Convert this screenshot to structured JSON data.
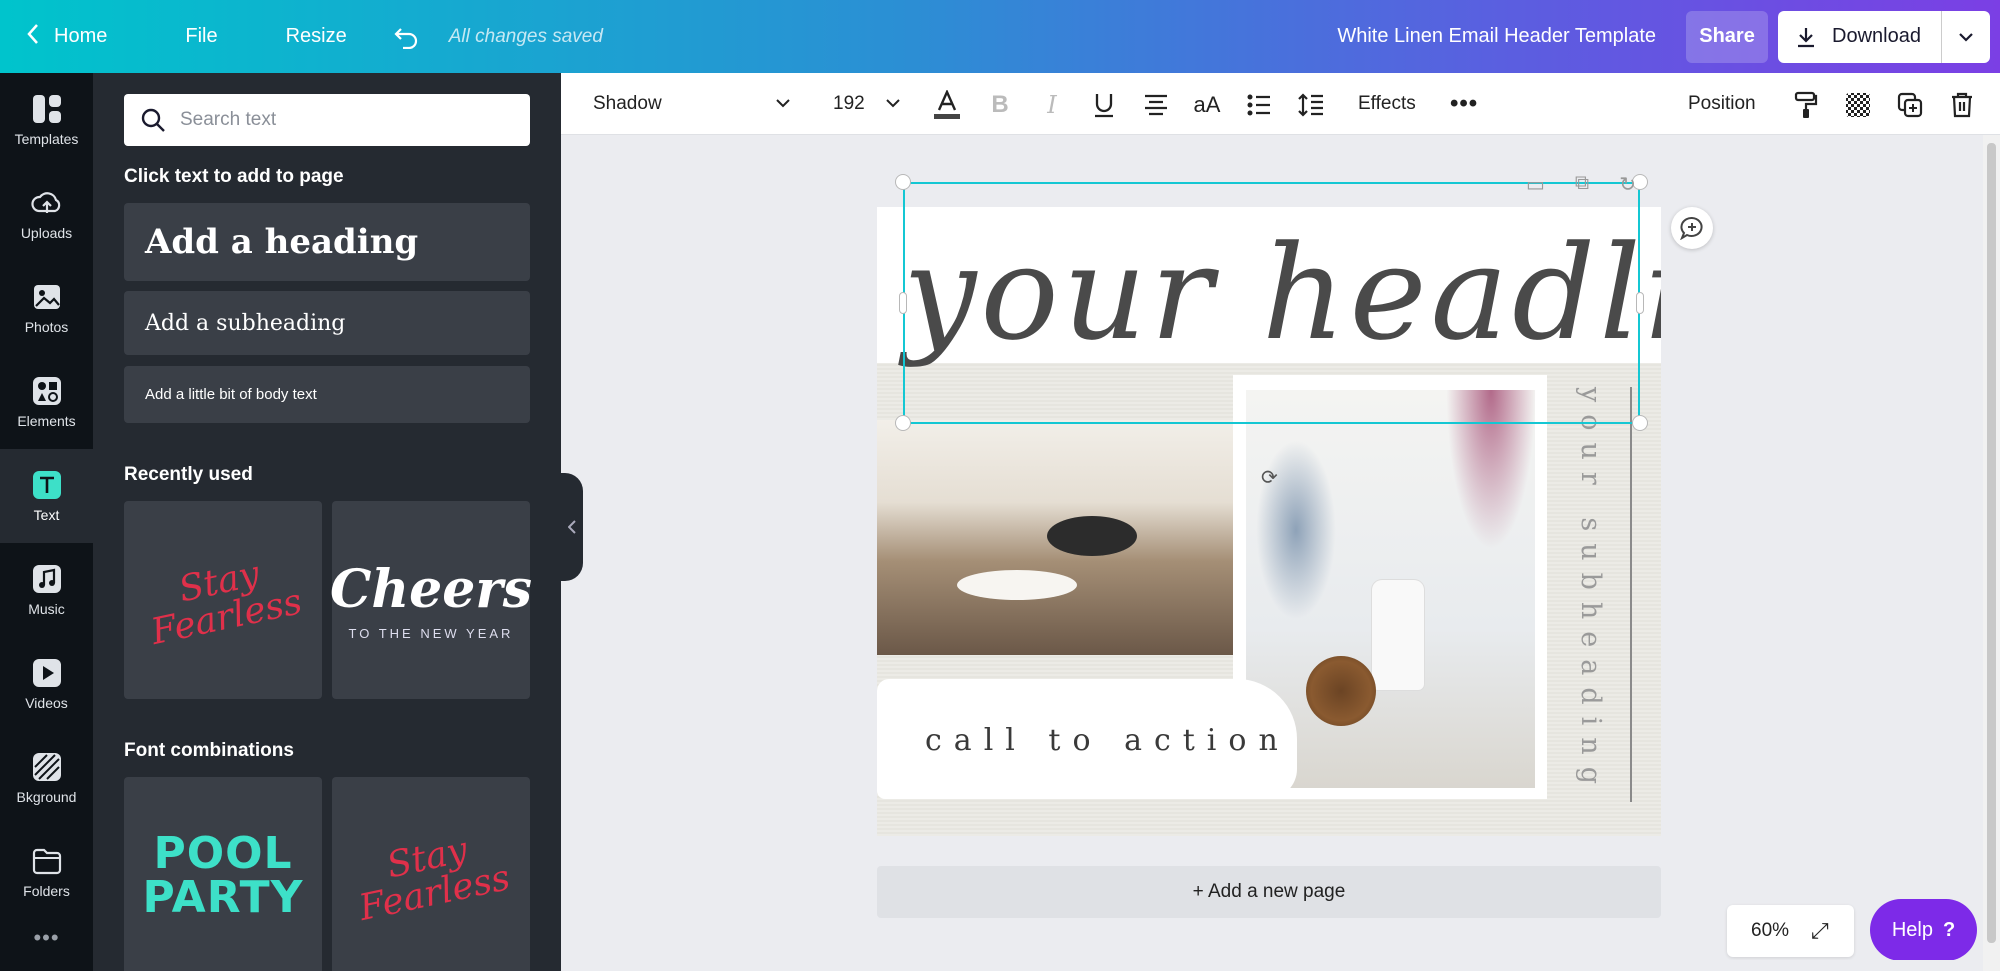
{
  "topbar": {
    "home_label": "Home",
    "file_label": "File",
    "resize_label": "Resize",
    "saved_status": "All changes saved",
    "doc_title": "White Linen Email Header Template",
    "share_label": "Share",
    "download_label": "Download"
  },
  "rail": {
    "items": [
      {
        "label": "Templates",
        "icon": "templates-icon"
      },
      {
        "label": "Uploads",
        "icon": "upload-icon"
      },
      {
        "label": "Photos",
        "icon": "photo-icon"
      },
      {
        "label": "Elements",
        "icon": "elements-icon"
      },
      {
        "label": "Text",
        "icon": "text-icon"
      },
      {
        "label": "Music",
        "icon": "music-icon"
      },
      {
        "label": "Videos",
        "icon": "video-icon"
      },
      {
        "label": "Bkground",
        "icon": "background-icon"
      },
      {
        "label": "Folders",
        "icon": "folder-icon"
      }
    ],
    "more_label": "•••"
  },
  "panel": {
    "search_placeholder": "Search text",
    "click_text_title": "Click text to add to page",
    "add_heading": "Add a heading",
    "add_subheading": "Add a subheading",
    "add_body": "Add a little bit of body text",
    "recently_used_title": "Recently used",
    "recent_1_text": "Stay Fearless",
    "recent_2_big": "Cheers",
    "recent_2_small": "TO THE NEW YEAR",
    "font_combos_title": "Font combinations",
    "combo_1_text": "POOL PARTY",
    "combo_2_text": "Stay Fearless"
  },
  "toolbar": {
    "font_name": "Shadow",
    "font_size": "192",
    "effects_label": "Effects",
    "more_label": "•••",
    "position_label": "Position"
  },
  "canvas": {
    "headline": "your headline",
    "subheading": "your subheading",
    "cta": "call to action",
    "add_page_label": "+ Add a new page"
  },
  "footer": {
    "zoom_level": "60%",
    "help_label": "Help",
    "help_mark": "?"
  },
  "colors": {
    "accent_teal": "#00c4cc",
    "accent_purple": "#7d2ae8",
    "selection": "#14c7d3"
  }
}
